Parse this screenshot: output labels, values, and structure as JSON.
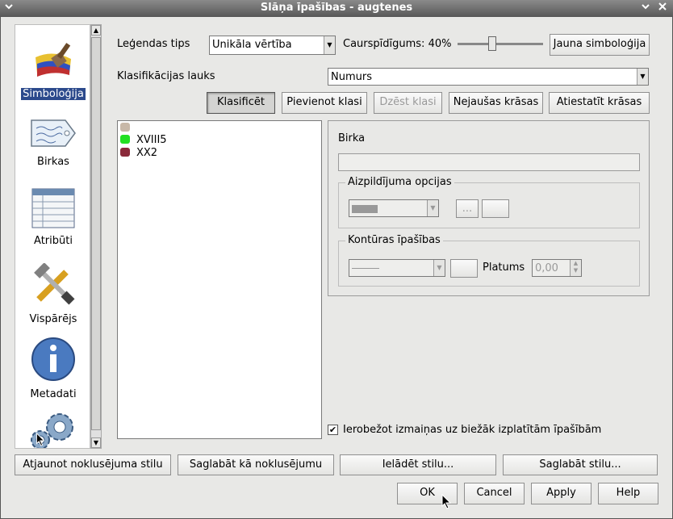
{
  "window": {
    "title": "Slāņa īpašības - augtenes",
    "menu_icon": "chevron-down-icon",
    "minimize_icon": "chevron-down-icon",
    "close_icon": "close-icon"
  },
  "sidebar": {
    "items": [
      {
        "label": "Simboloģija",
        "icon": "symbology-brush-icon",
        "active": true
      },
      {
        "label": "Birkas",
        "icon": "label-tag-icon"
      },
      {
        "label": "Atribūti",
        "icon": "attribute-table-icon"
      },
      {
        "label": "Vispārējs",
        "icon": "general-tools-icon"
      },
      {
        "label": "Metadati",
        "icon": "info-icon"
      },
      {
        "label": "",
        "icon": "gear-icon"
      }
    ]
  },
  "symbology": {
    "legend_type_label": "Leģendas tips",
    "legend_type_value": "Unikāla vērtība",
    "transparency_label": "Caurspīdīgums: 40%",
    "transparency_value": 40,
    "new_symbology_button": "Jauna simboloģija",
    "classification_field_label": "Klasifikācijas lauks",
    "classification_field_value": "Numurs",
    "buttons": {
      "classify": "Klasificēt",
      "add_class": "Pievienot klasi",
      "delete_class": "Dzēst klasi",
      "random_colors": "Nejaušas krāsas",
      "reset_colors": "Atiestatīt krāsas"
    },
    "classes": [
      {
        "label": "",
        "color": "#c8b8a8"
      },
      {
        "label": "XVIII5",
        "color": "#22e022"
      },
      {
        "label": "XX2",
        "color": "#8a2a3a"
      }
    ],
    "properties": {
      "tag_label": "Birka",
      "tag_value": "",
      "fill_group_title": "Aizpildījuma opcijas",
      "fill_more_button": "...",
      "outline_group_title": "Kontūras īpašības",
      "width_label": "Platums",
      "width_value": "0,00"
    },
    "restrict_checkbox_label": "Ierobežot izmaiņas uz biežāk izplatītām īpašībām",
    "restrict_checked": true
  },
  "style_buttons": {
    "restore_default": "Atjaunot noklusējuma stilu",
    "save_as_default": "Saglabāt kā noklusējumu",
    "load_style": "Ielādēt stilu...",
    "save_style": "Saglabāt stilu..."
  },
  "dialog_buttons": {
    "ok": "OK",
    "cancel": "Cancel",
    "apply": "Apply",
    "help": "Help"
  }
}
